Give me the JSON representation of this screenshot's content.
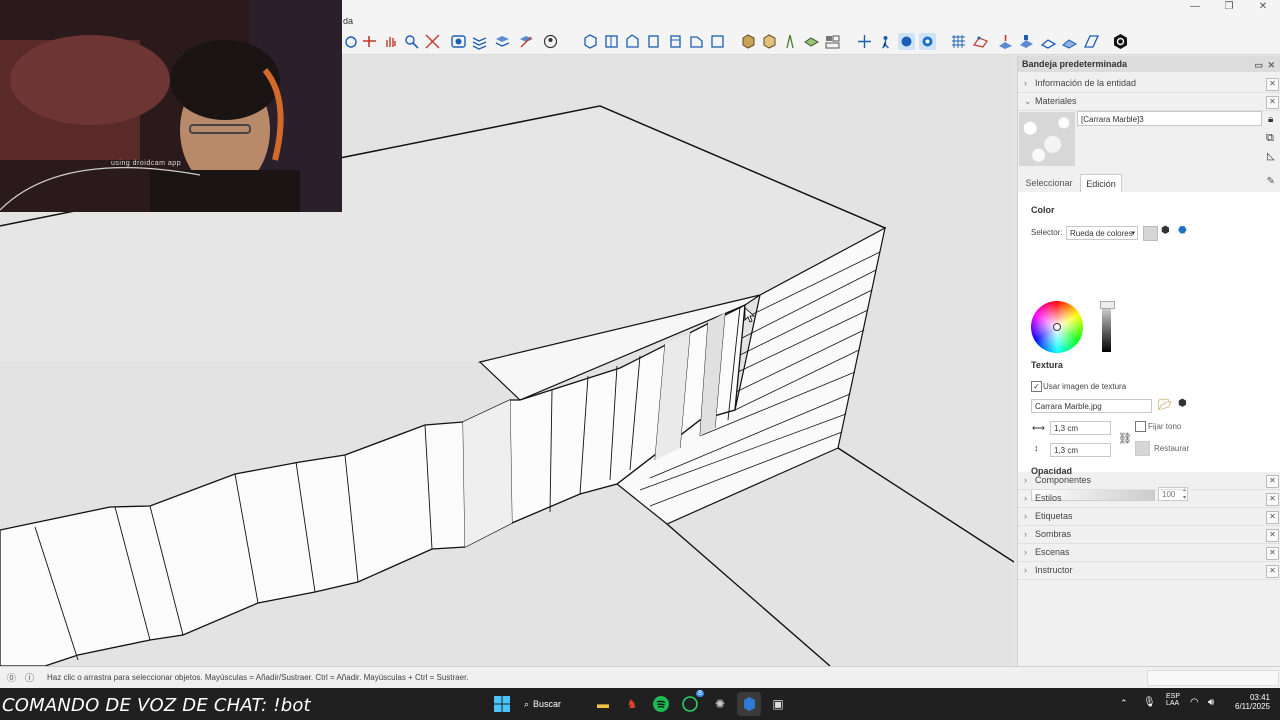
{
  "titlebar": {
    "menu_fragment": "da",
    "window_controls": [
      "—",
      "❐",
      "✕"
    ]
  },
  "webcam": {
    "caption": "using droidcam app"
  },
  "tray": {
    "title": "Bandeja predeterminada",
    "sections_top": [
      {
        "label": "Información de la entidad",
        "expanded": false
      },
      {
        "label": "Materiales",
        "expanded": true
      }
    ],
    "material_name": "[Carrara Marble]3",
    "tabs": [
      "Seleccionar",
      "Edición"
    ],
    "active_tab": "Edición",
    "edit": {
      "color_label": "Color",
      "selector_label": "Selector:",
      "selector_value": "Rueda de colores",
      "texture_label": "Textura",
      "use_texture_label": "Usar imagen de textura",
      "use_texture_checked": true,
      "texture_file": "Carrara Marble.jpg",
      "width_value": "1,3 cm",
      "height_value": "1,3 cm",
      "fix_tone_label": "Fijar tono",
      "restore_label": "Restaurar",
      "opacity_label": "Opacidad",
      "opacity_value": "100"
    },
    "sections_bottom": [
      {
        "label": "Componentes"
      },
      {
        "label": "Estilos"
      },
      {
        "label": "Etiquetas"
      },
      {
        "label": "Sombras"
      },
      {
        "label": "Escenas"
      },
      {
        "label": "Instructor"
      }
    ]
  },
  "status": {
    "text": "Haz clic o arrastra para seleccionar objetos. Mayúsculas = Añadir/Sustraer. Ctrl = Añadir. Mayúsculas + Ctrl = Sustraer."
  },
  "overlay": {
    "text": "COMANDO DE VOZ DE CHAT: !bot"
  },
  "taskbar": {
    "search_label": "Buscar",
    "lang": "ESP",
    "lang2": "LAA",
    "time": "03:41",
    "date": "6/11/2025",
    "badge_count": "8"
  },
  "colors": {
    "accent": "#1a73c8",
    "taskbar": "#202020",
    "viewport": "#e3e3e3"
  }
}
